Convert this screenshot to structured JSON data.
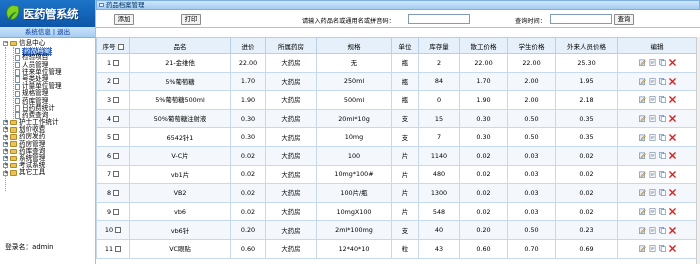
{
  "app": {
    "title": "医药管系统"
  },
  "userbar": {
    "info": "系统信息",
    "sep": "|",
    "logout": "退出"
  },
  "tree": {
    "root": "信息中心",
    "children": [
      "药品档案",
      "检验项目",
      "人员管理",
      "往来单位管理",
      "号类处理",
      "计量单位管理",
      "规格管理",
      "药库管理",
      "日药费统计",
      "药费查询"
    ],
    "groups": [
      "护士工作统计",
      "划价收费",
      "药房发药",
      "药房管理",
      "药库查询",
      "系统管理",
      "考试系统",
      "其它工具"
    ]
  },
  "login": {
    "label": "登录名：admin"
  },
  "panel": {
    "title": "药品档案管理"
  },
  "toolbar": {
    "add": "添加",
    "print": "打印",
    "search_label": "请输入药品名或通用名或拼音码：",
    "search_value": "",
    "date_label": "查询时间：",
    "date_value": "",
    "query": "查询"
  },
  "table": {
    "headers": [
      "序号",
      "品名",
      "进价",
      "所属药房",
      "规格",
      "单位",
      "库存量",
      "散工价格",
      "学生价格",
      "外来人员价格",
      "编辑"
    ],
    "rows": [
      [
        "1",
        "21-金维他",
        "22.00",
        "大药房",
        "无",
        "瓶",
        "2",
        "22.00",
        "22.00",
        "25.30"
      ],
      [
        "2",
        "5%葡萄糖",
        "1.70",
        "大药房",
        "250ml",
        "瓶",
        "84",
        "1.70",
        "2.00",
        "1.95"
      ],
      [
        "3",
        "5%葡萄糖500ml",
        "1.90",
        "大药房",
        "500ml",
        "瓶",
        "0",
        "1.90",
        "2.00",
        "2.18"
      ],
      [
        "4",
        "50%葡萄糖注射液",
        "0.30",
        "大药房",
        "20ml*10g",
        "支",
        "15",
        "0.30",
        "0.50",
        "0.35"
      ],
      [
        "5",
        "6542针1",
        "0.30",
        "大药房",
        "10mg",
        "支",
        "7",
        "0.30",
        "0.50",
        "0.35"
      ],
      [
        "6",
        "V-C片",
        "0.02",
        "大药房",
        "100",
        "片",
        "1140",
        "0.02",
        "0.03",
        "0.02"
      ],
      [
        "7",
        "vb1片",
        "0.02",
        "大药房",
        "10mg*100#",
        "片",
        "480",
        "0.02",
        "0.03",
        "0.02"
      ],
      [
        "8",
        "VB2",
        "0.02",
        "大药房",
        "100片/瓶",
        "片",
        "1300",
        "0.02",
        "0.03",
        "0.02"
      ],
      [
        "9",
        "vb6",
        "0.02",
        "大药房",
        "10mgX100",
        "片",
        "548",
        "0.02",
        "0.03",
        "0.02"
      ],
      [
        "10",
        "vb6针",
        "0.20",
        "大药房",
        "2ml*100mg",
        "支",
        "40",
        "0.20",
        "0.50",
        "0.23"
      ],
      [
        "11",
        "VC眼贴",
        "0.60",
        "大药房",
        "12*40*10",
        "粒",
        "43",
        "0.60",
        "0.70",
        "0.69"
      ]
    ]
  },
  "icons": [
    "edit-icon",
    "view-icon",
    "copy-icon",
    "delete-icon"
  ],
  "colors": {
    "header_blue": "#1d74c9",
    "select_blue": "#316ac5",
    "delete_red": "#d92020"
  }
}
